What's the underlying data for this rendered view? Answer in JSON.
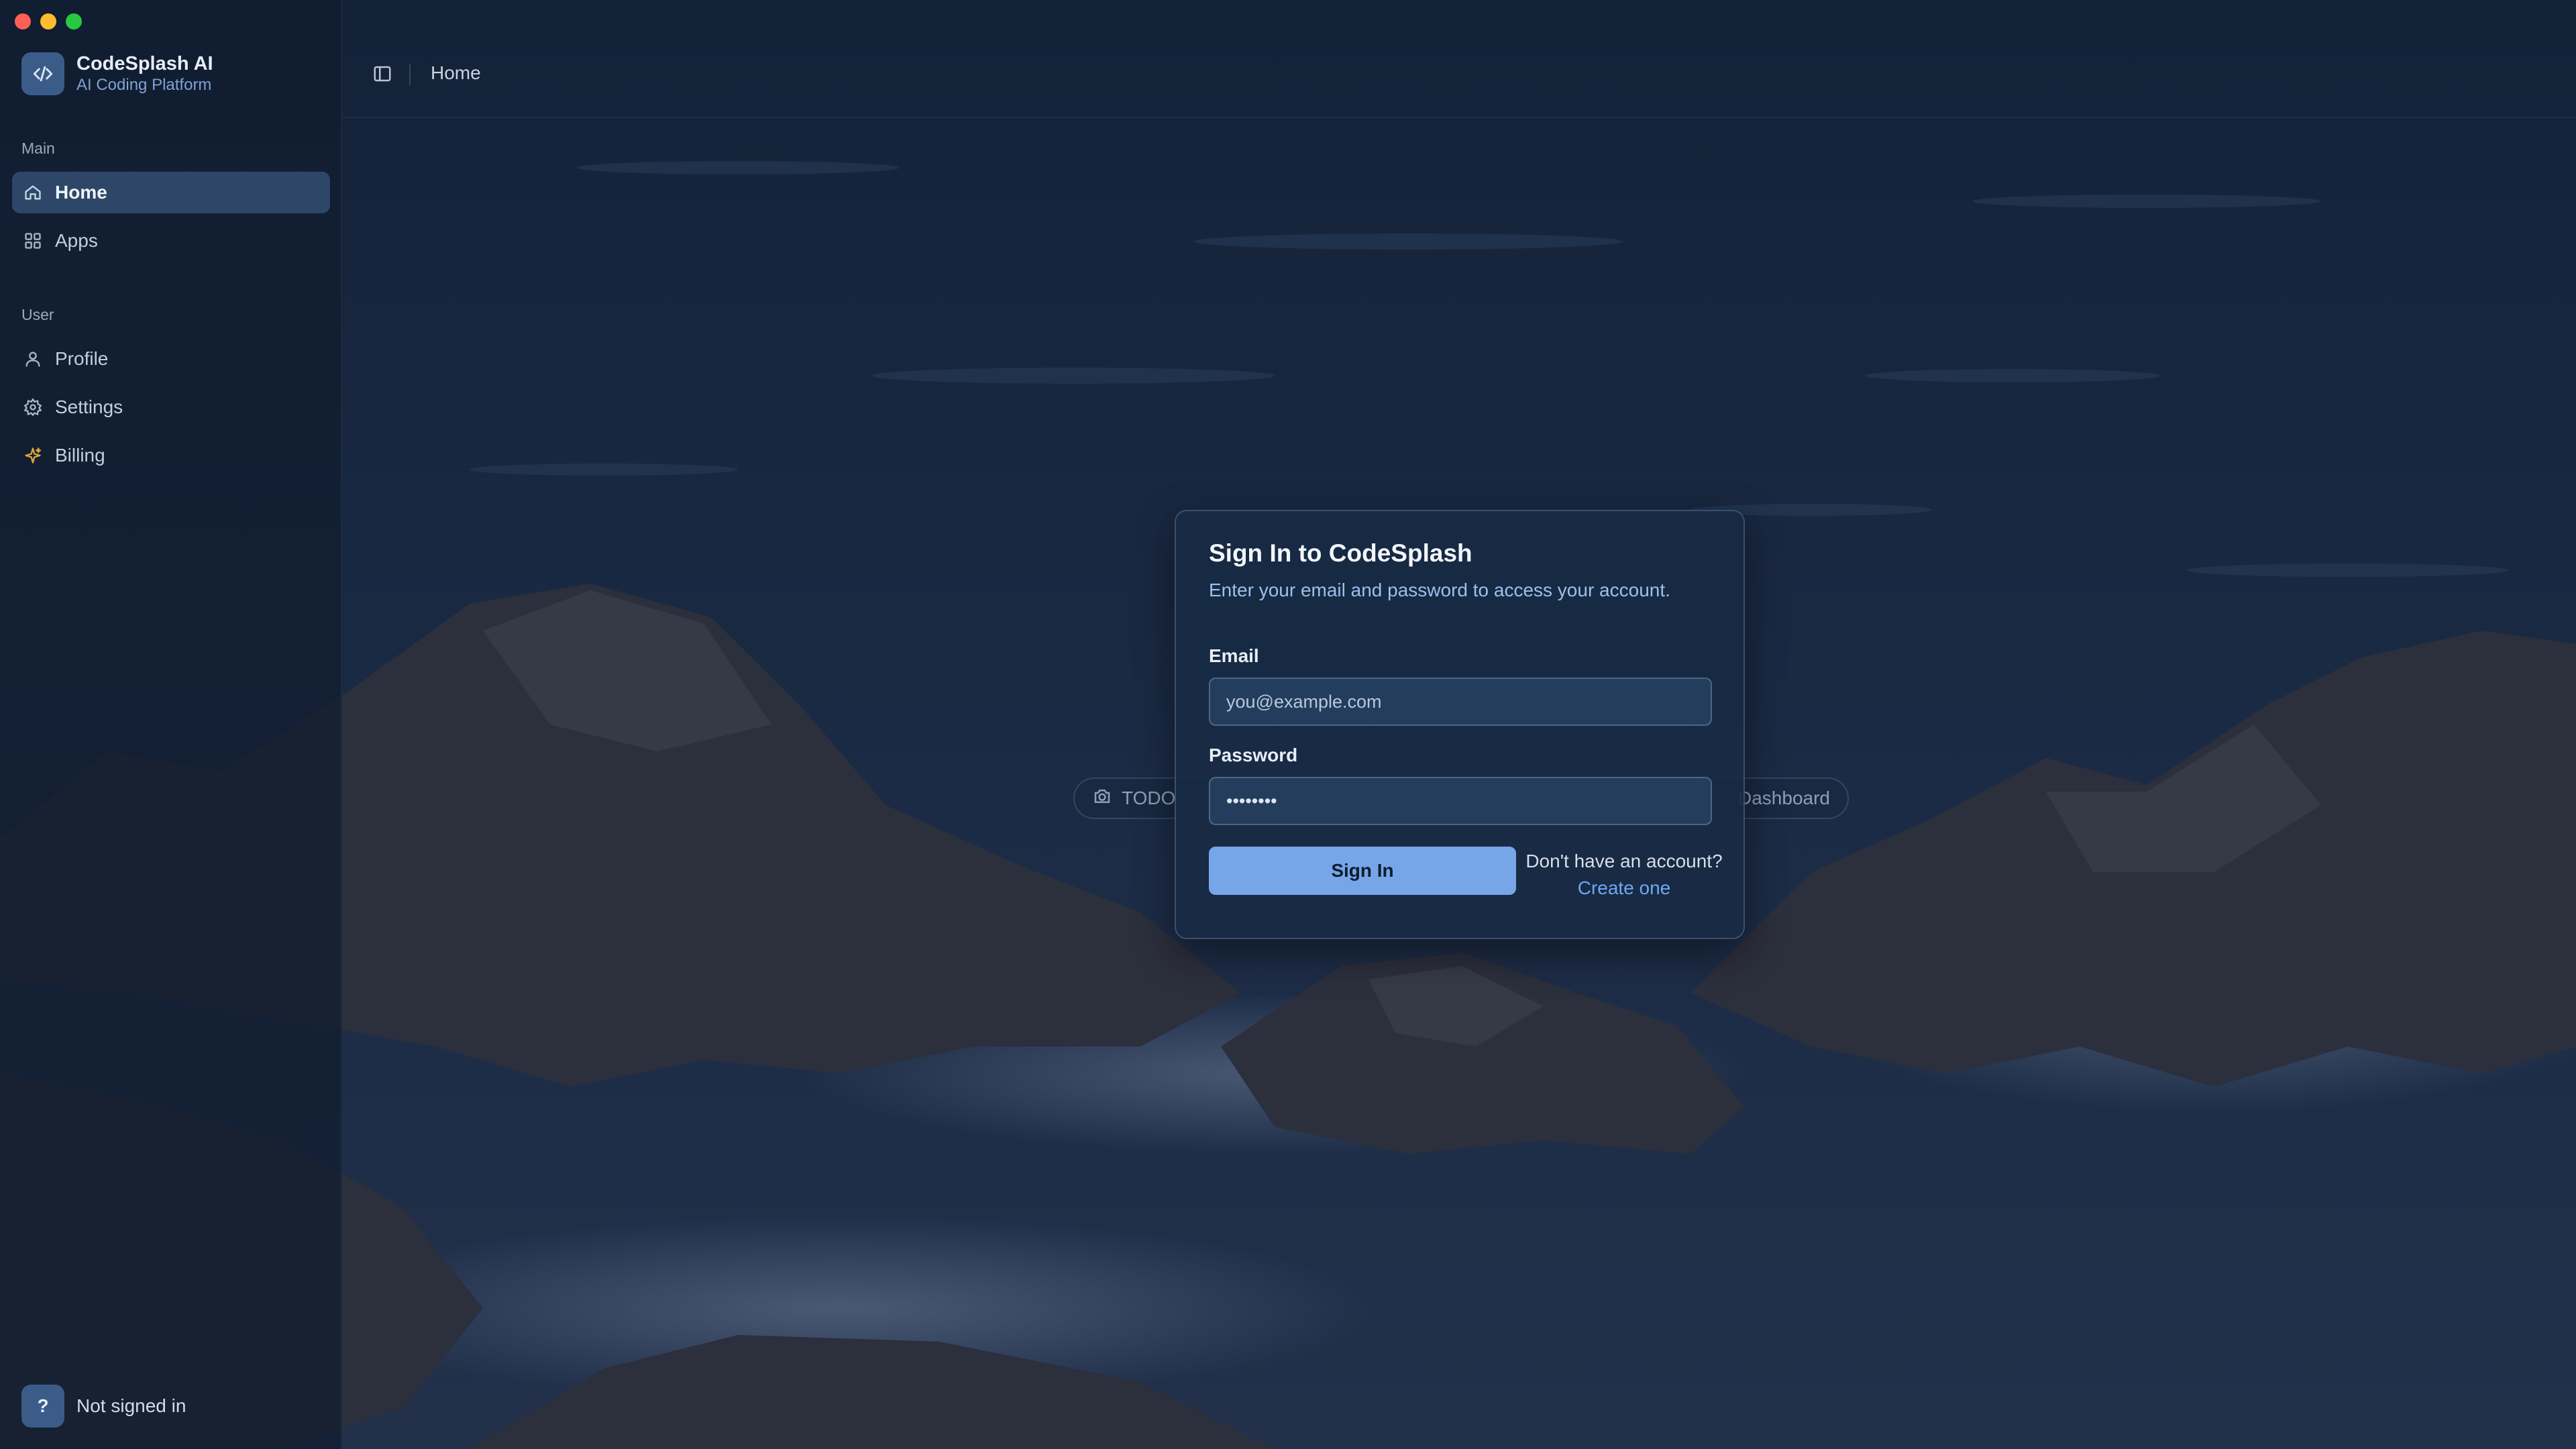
{
  "window": {
    "controls": [
      "close",
      "minimize",
      "zoom"
    ]
  },
  "brand": {
    "name": "CodeSplash AI",
    "subtitle": "AI Coding Platform",
    "logo_icon": "code-icon"
  },
  "sidebar": {
    "sections": [
      {
        "label": "Main",
        "items": [
          {
            "label": "Home",
            "icon": "home-icon",
            "active": true
          },
          {
            "label": "Apps",
            "icon": "grid-icon",
            "active": false
          }
        ]
      },
      {
        "label": "User",
        "items": [
          {
            "label": "Profile",
            "icon": "user-icon",
            "active": false
          },
          {
            "label": "Settings",
            "icon": "gear-icon",
            "active": false
          },
          {
            "label": "Billing",
            "icon": "sparkle-icon",
            "active": false
          }
        ]
      }
    ],
    "footer": {
      "badge": "?",
      "status": "Not signed in"
    }
  },
  "header": {
    "breadcrumb": "Home",
    "toggle_icon": "sidebar-toggle-icon"
  },
  "background_chips": [
    {
      "label": "TODO",
      "icon": "camera-icon"
    },
    {
      "label": "Dashboard"
    }
  ],
  "signin_modal": {
    "title": "Sign In to CodeSplash",
    "subtitle": "Enter your email and password to access your account.",
    "email": {
      "label": "Email",
      "placeholder": "you@example.com",
      "value": ""
    },
    "password": {
      "label": "Password",
      "value": "••••••••"
    },
    "submit_label": "Sign In",
    "signup_prompt": "Don't have an account?",
    "signup_link": "Create one"
  },
  "colors": {
    "accent": "#76a6e8",
    "link": "#6fa8f2",
    "active_nav": "#3e5f87",
    "close": "#fe5f57",
    "minimize": "#febc2e",
    "zoom": "#28c840"
  }
}
